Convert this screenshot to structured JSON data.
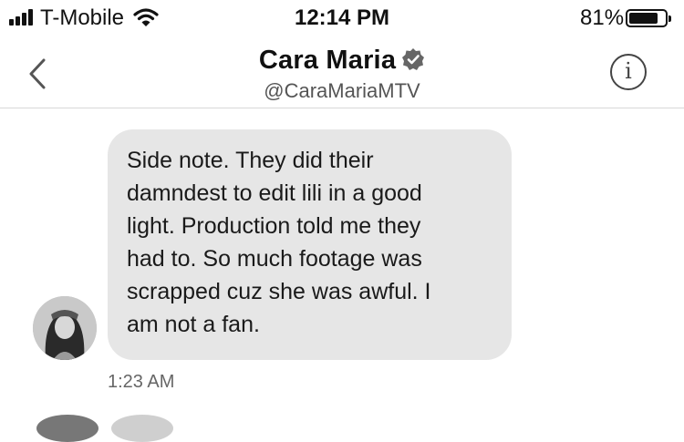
{
  "status_bar": {
    "carrier": "T-Mobile",
    "time": "12:14 PM",
    "battery_percent": "81%",
    "battery_level": 0.81,
    "icons": [
      "signal-icon",
      "wifi-icon",
      "battery-icon"
    ]
  },
  "header": {
    "name": "Cara Maria",
    "handle": "@CaraMariaMTV",
    "icons": [
      "back-chevron-icon",
      "verified-badge-icon",
      "info-icon"
    ]
  },
  "conversation": {
    "messages": [
      {
        "text": "Side note. They did their\ndamndest to edit lili in a good\nlight. Production told me they\nhad to. So much footage was\nscrapped cuz she was awful. I\nam not a fan.",
        "timestamp": "1:23 AM"
      }
    ]
  },
  "colors": {
    "bubble": "#e6e6e6",
    "text": "#111111",
    "secondary_text": "#666666",
    "divider": "#d8d8d8"
  }
}
